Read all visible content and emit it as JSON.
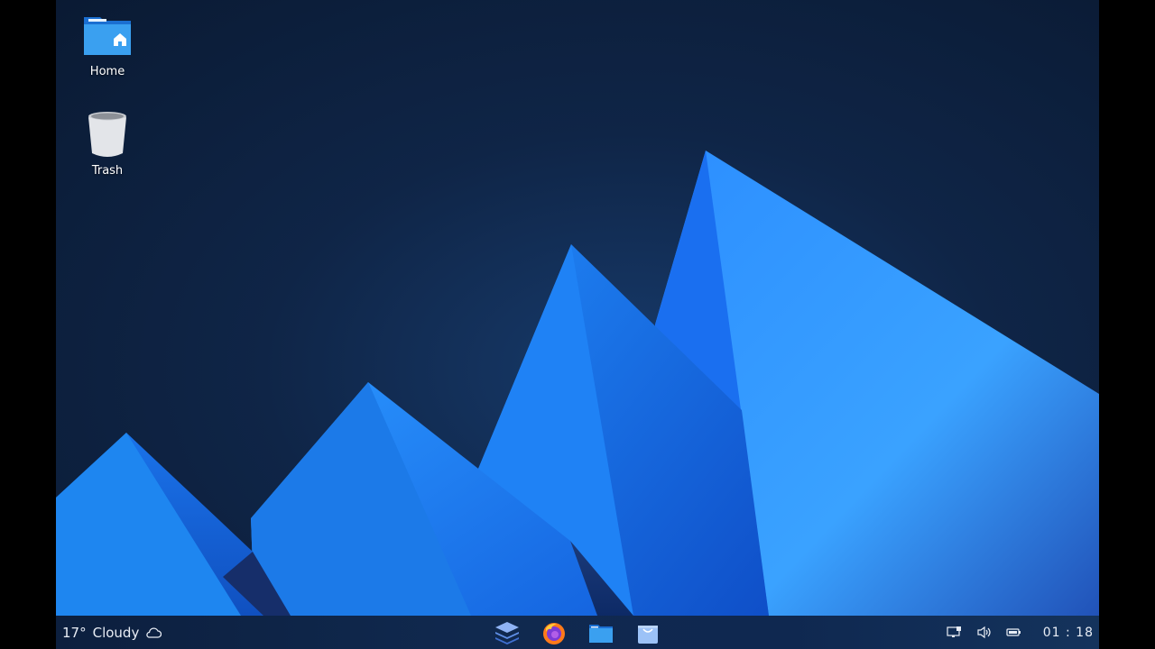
{
  "desktop": {
    "icons": [
      {
        "label": "Home",
        "icon": "home-folder-icon"
      },
      {
        "label": "Trash",
        "icon": "trash-icon"
      }
    ]
  },
  "taskbar": {
    "weather": {
      "temperature": "17°",
      "condition": "Cloudy",
      "icon": "cloud-icon"
    },
    "dock": [
      {
        "name": "layers-app",
        "icon": "layers-icon"
      },
      {
        "name": "firefox",
        "icon": "firefox-icon"
      },
      {
        "name": "files",
        "icon": "folder-icon"
      },
      {
        "name": "app-store",
        "icon": "store-bag-icon"
      }
    ],
    "tray": [
      {
        "name": "network",
        "icon": "network-icon"
      },
      {
        "name": "volume",
        "icon": "volume-icon"
      },
      {
        "name": "battery",
        "icon": "battery-icon"
      }
    ],
    "clock": "01 : 18"
  },
  "colors": {
    "background_dark": "#0a1a33",
    "accent": "#1e8cff",
    "taskbar": "#10294f"
  }
}
